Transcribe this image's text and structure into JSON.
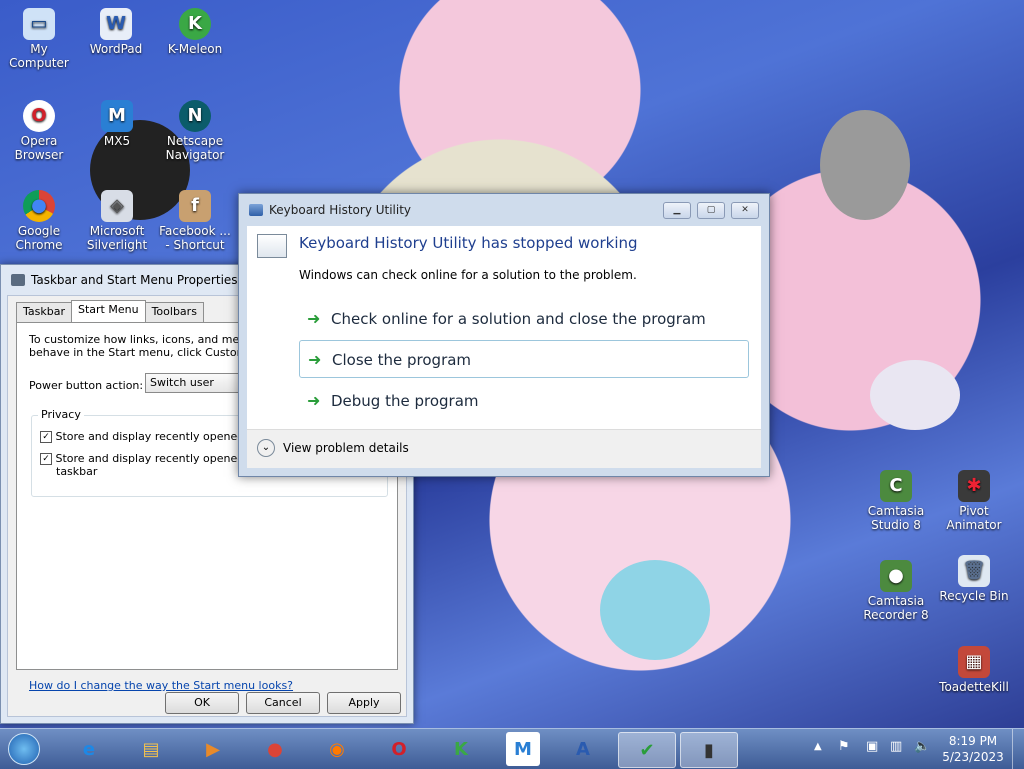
{
  "desktop_icons": [
    {
      "label": "My Computer",
      "icon": "computer-icon"
    },
    {
      "label": "WordPad",
      "icon": "wordpad-icon"
    },
    {
      "label": "K-Meleon",
      "icon": "kmeleon-icon"
    },
    {
      "label": "Opera Browser",
      "icon": "opera-icon"
    },
    {
      "label": "MX5",
      "icon": "mx5-icon"
    },
    {
      "label": "Netscape Navigator",
      "icon": "netscape-icon"
    },
    {
      "label": "Google Chrome",
      "icon": "chrome-icon"
    },
    {
      "label": "Microsoft Silverlight",
      "icon": "silverlight-icon"
    },
    {
      "label": "Facebook ... - Shortcut",
      "icon": "facebook-icon"
    },
    {
      "label": "Camtasia Studio 8",
      "icon": "camtasia-icon"
    },
    {
      "label": "Pivot Animator",
      "icon": "pivot-icon"
    },
    {
      "label": "Camtasia Recorder 8",
      "icon": "camtasia-recorder-icon"
    },
    {
      "label": "Recycle Bin",
      "icon": "recycle-bin-icon"
    },
    {
      "label": "ToadetteKill",
      "icon": "toadette-icon"
    }
  ],
  "taskbar_props": {
    "title": "Taskbar and Start Menu Properties",
    "tabs": [
      "Taskbar",
      "Start Menu",
      "Toolbars"
    ],
    "intro_line1": "To customize how links, icons, and menus lo",
    "intro_line2": "behave in the Start menu, click Customize.",
    "power_label": "Power button action:",
    "power_value": "Switch user",
    "privacy_label": "Privacy",
    "check1": "Store and display recently opened pro",
    "check2_line1": "Store and display recently opened iten",
    "check2_line2": "taskbar",
    "help_link": "How do I change the way the Start menu looks?",
    "ok": "OK",
    "cancel": "Cancel",
    "apply": "Apply"
  },
  "error_dialog": {
    "title": "Keyboard History Utility",
    "heading": "Keyboard History Utility has stopped working",
    "subtext": "Windows can check online for a solution to the problem.",
    "options": [
      "Check online for a solution and close the program",
      "Close the program",
      "Debug the program"
    ],
    "details": "View problem details"
  },
  "taskbar": {
    "time": "8:19 PM",
    "date": "5/23/2023"
  }
}
